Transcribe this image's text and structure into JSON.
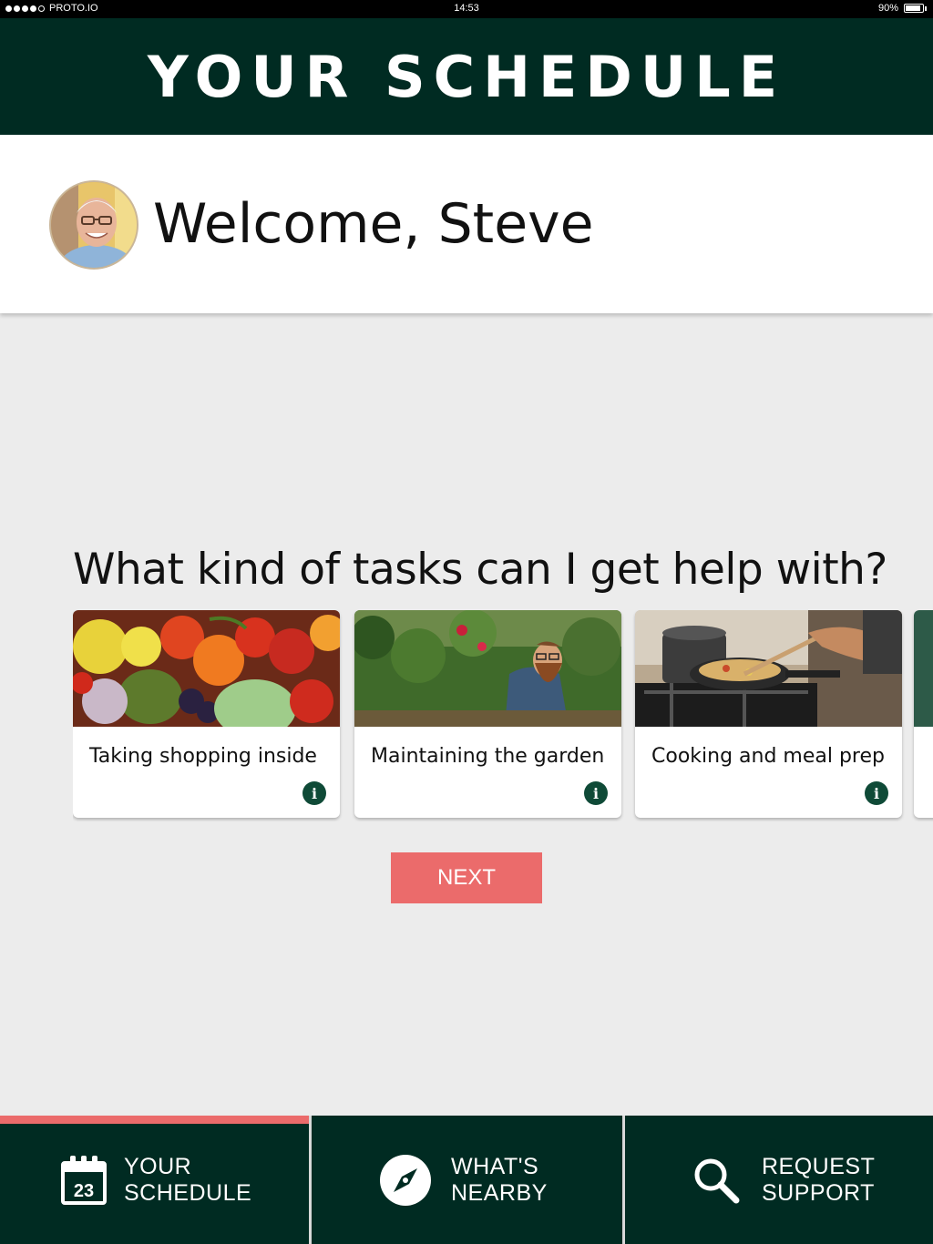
{
  "status_bar": {
    "carrier": "PROTO.IO",
    "time": "14:53",
    "battery": "90%",
    "battery_level": 0.9
  },
  "header": {
    "title": "YOUR SCHEDULE"
  },
  "welcome": {
    "text": "Welcome, Steve"
  },
  "question": "What kind of tasks can I get help with?",
  "cards": [
    {
      "title": "Taking shopping inside",
      "image": "fruit-vegetables"
    },
    {
      "title": "Maintaining the garden",
      "image": "gardener"
    },
    {
      "title": "Cooking and meal prep",
      "image": "cooking-pans"
    }
  ],
  "next_button": "NEXT",
  "tabs": [
    {
      "line1": "YOUR",
      "line2": "SCHEDULE",
      "icon": "calendar-icon",
      "icon_text": "23",
      "active": true
    },
    {
      "line1": "WHAT'S",
      "line2": "NEARBY",
      "icon": "compass-icon",
      "active": false
    },
    {
      "line1": "REQUEST",
      "line2": "SUPPORT",
      "icon": "search-icon",
      "active": false
    }
  ],
  "colors": {
    "primary_dark": "#002b22",
    "accent": "#eb6b6b",
    "info_icon": "#0f4a37",
    "background": "#ececec"
  }
}
